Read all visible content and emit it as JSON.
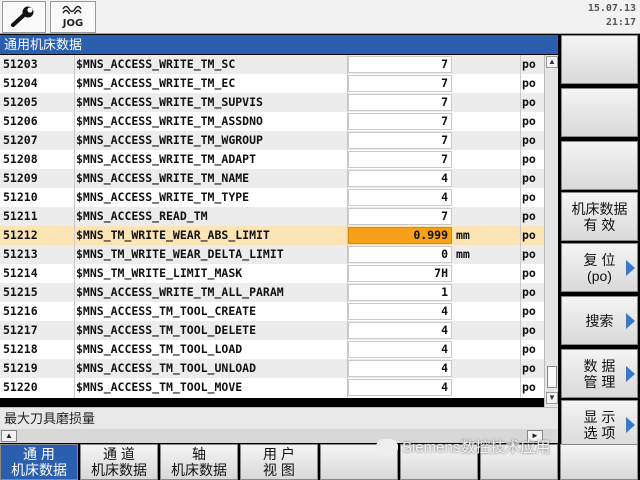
{
  "header": {
    "mode_label": "JOG",
    "date": "15.07.13",
    "time": "21:17"
  },
  "window_title": "通用机床数据",
  "rows": [
    {
      "no": "51203",
      "name": "$MNS_ACCESS_WRITE_TM_SC",
      "value": "7",
      "unit": "",
      "class": "po"
    },
    {
      "no": "51204",
      "name": "$MNS_ACCESS_WRITE_TM_EC",
      "value": "7",
      "unit": "",
      "class": "po"
    },
    {
      "no": "51205",
      "name": "$MNS_ACCESS_WRITE_TM_SUPVIS",
      "value": "7",
      "unit": "",
      "class": "po"
    },
    {
      "no": "51206",
      "name": "$MNS_ACCESS_WRITE_TM_ASSDNO",
      "value": "7",
      "unit": "",
      "class": "po"
    },
    {
      "no": "51207",
      "name": "$MNS_ACCESS_WRITE_TM_WGROUP",
      "value": "7",
      "unit": "",
      "class": "po"
    },
    {
      "no": "51208",
      "name": "$MNS_ACCESS_WRITE_TM_ADAPT",
      "value": "7",
      "unit": "",
      "class": "po"
    },
    {
      "no": "51209",
      "name": "$MNS_ACCESS_WRITE_TM_NAME",
      "value": "4",
      "unit": "",
      "class": "po"
    },
    {
      "no": "51210",
      "name": "$MNS_ACCESS_WRITE_TM_TYPE",
      "value": "4",
      "unit": "",
      "class": "po"
    },
    {
      "no": "51211",
      "name": "$MNS_ACCESS_READ_TM",
      "value": "7",
      "unit": "",
      "class": "po"
    },
    {
      "no": "51212",
      "name": "$MNS_TM_WRITE_WEAR_ABS_LIMIT",
      "value": "0.999",
      "unit": "mm",
      "class": "po"
    },
    {
      "no": "51213",
      "name": "$MNS_TM_WRITE_WEAR_DELTA_LIMIT",
      "value": "0",
      "unit": "mm",
      "class": "po"
    },
    {
      "no": "51214",
      "name": "$MNS_TM_WRITE_LIMIT_MASK",
      "value": "7H",
      "unit": "",
      "class": "po"
    },
    {
      "no": "51215",
      "name": "$MNS_ACCESS_WRITE_TM_ALL_PARAM",
      "value": "1",
      "unit": "",
      "class": "po"
    },
    {
      "no": "51216",
      "name": "$MNS_ACCESS_TM_TOOL_CREATE",
      "value": "4",
      "unit": "",
      "class": "po"
    },
    {
      "no": "51217",
      "name": "$MNS_ACCESS_TM_TOOL_DELETE",
      "value": "4",
      "unit": "",
      "class": "po"
    },
    {
      "no": "51218",
      "name": "$MNS_ACCESS_TM_TOOL_LOAD",
      "value": "4",
      "unit": "",
      "class": "po"
    },
    {
      "no": "51219",
      "name": "$MNS_ACCESS_TM_TOOL_UNLOAD",
      "value": "4",
      "unit": "",
      "class": "po"
    },
    {
      "no": "51220",
      "name": "$MNS_ACCESS_TM_TOOL_MOVE",
      "value": "4",
      "unit": "",
      "class": "po"
    }
  ],
  "selected_row": 9,
  "description": "最大刀具磨损量",
  "vertical_softkeys": [
    {
      "line1": "",
      "line2": "",
      "arrow": false
    },
    {
      "line1": "",
      "line2": "",
      "arrow": false
    },
    {
      "line1": "",
      "line2": "",
      "arrow": false
    },
    {
      "line1": "机床数据",
      "line2": "有 效",
      "arrow": false
    },
    {
      "line1": "复 位",
      "line2": "(po)",
      "arrow": true
    },
    {
      "line1": "搜索",
      "line2": "",
      "arrow": true
    },
    {
      "line1": "数 据",
      "line2": "管 理",
      "arrow": true
    },
    {
      "line1": "显 示",
      "line2": "选 项",
      "arrow": true
    }
  ],
  "horizontal_softkeys": [
    {
      "line1": "通 用",
      "line2": "机床数据",
      "active": true
    },
    {
      "line1": "通 道",
      "line2": "机床数据",
      "active": false
    },
    {
      "line1": "轴",
      "line2": "机床数据",
      "active": false
    },
    {
      "line1": "用 户",
      "line2": "视 图",
      "active": false
    },
    {
      "line1": "",
      "line2": "",
      "active": false
    },
    {
      "line1": "",
      "line2": "",
      "active": false
    },
    {
      "line1": "",
      "line2": "",
      "active": false
    },
    {
      "line1": "",
      "line2": "",
      "active": false
    }
  ],
  "watermark": "Siemens数控技术应用",
  "colors": {
    "title_bar": "#2a5fb0",
    "selected_row": "#fde4b4",
    "selected_value": "#f7a11a",
    "softkey_arrow": "#3a78c9"
  },
  "icons": [
    "wrench-icon",
    "jog-wave-icon",
    "scroll-up-icon",
    "scroll-down-icon",
    "scroll-left-icon",
    "scroll-right-icon"
  ]
}
